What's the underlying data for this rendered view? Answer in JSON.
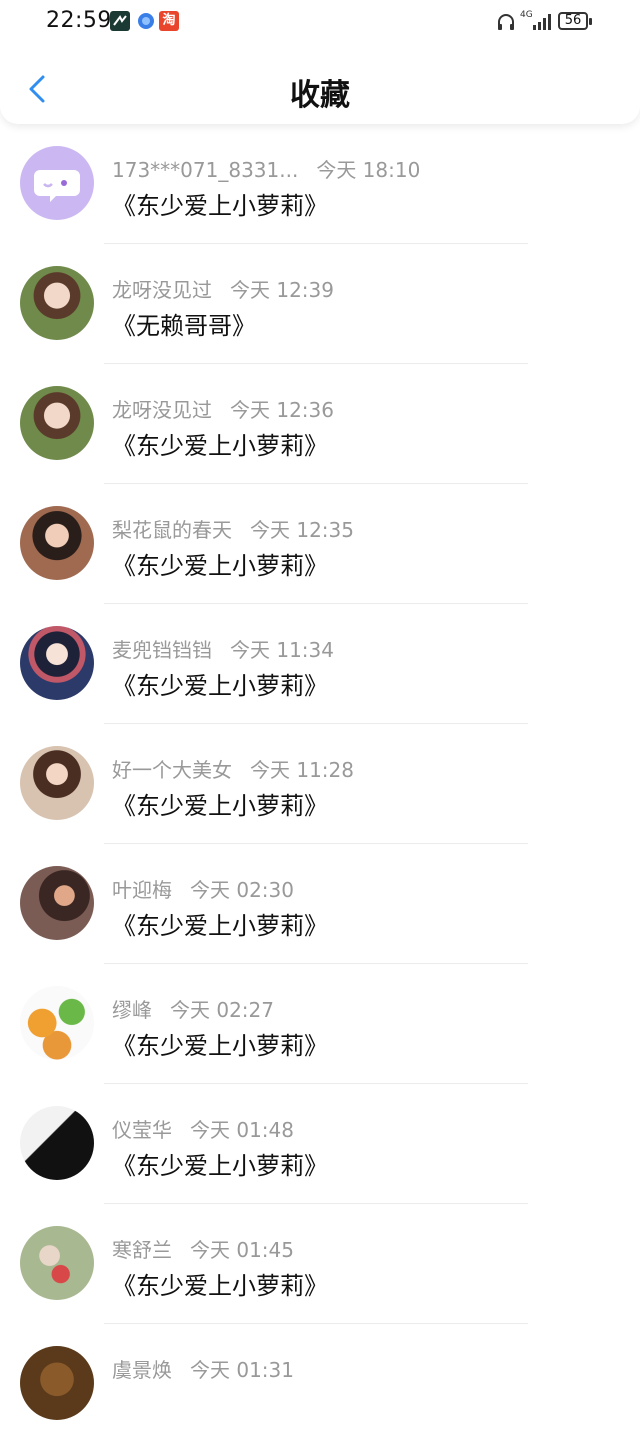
{
  "status_bar": {
    "time": "22:59",
    "network": "4G",
    "battery": "56",
    "app_icon_3_text": "淘"
  },
  "header": {
    "title": "收藏"
  },
  "items": [
    {
      "name": "173***071_8331...",
      "time": "今天 18:10",
      "content": "《东少爱上小萝莉》",
      "avatar_color": "#c9b6f0"
    },
    {
      "name": "龙呀没见过",
      "time": "今天 12:39",
      "content": "《无赖哥哥》",
      "avatar_color": "#6f8a4a"
    },
    {
      "name": "龙呀没见过",
      "time": "今天 12:36",
      "content": "《东少爱上小萝莉》",
      "avatar_color": "#6f8a4a"
    },
    {
      "name": "梨花鼠的春天",
      "time": "今天 12:35",
      "content": "《东少爱上小萝莉》",
      "avatar_color": "#8a5a48"
    },
    {
      "name": "麦兜铛铛铛",
      "time": "今天 11:34",
      "content": "《东少爱上小萝莉》",
      "avatar_color": "#3a4a78"
    },
    {
      "name": "好一个大美女",
      "time": "今天 11:28",
      "content": "《东少爱上小萝莉》",
      "avatar_color": "#b89a86"
    },
    {
      "name": "叶迎梅",
      "time": "今天 02:30",
      "content": "《东少爱上小萝莉》",
      "avatar_color": "#4a3a34"
    },
    {
      "name": "缪峰",
      "time": "今天 02:27",
      "content": "《东少爱上小萝莉》",
      "avatar_color": "#e8a848"
    },
    {
      "name": "仪莹华",
      "time": "今天 01:48",
      "content": "《东少爱上小萝莉》",
      "avatar_color": "#1a1a1a"
    },
    {
      "name": "寒舒兰",
      "time": "今天 01:45",
      "content": "《东少爱上小萝莉》",
      "avatar_color": "#a8b890"
    },
    {
      "name": "虞景焕",
      "time": "今天 01:31",
      "content": "",
      "avatar_color": "#6a4a2a"
    }
  ]
}
